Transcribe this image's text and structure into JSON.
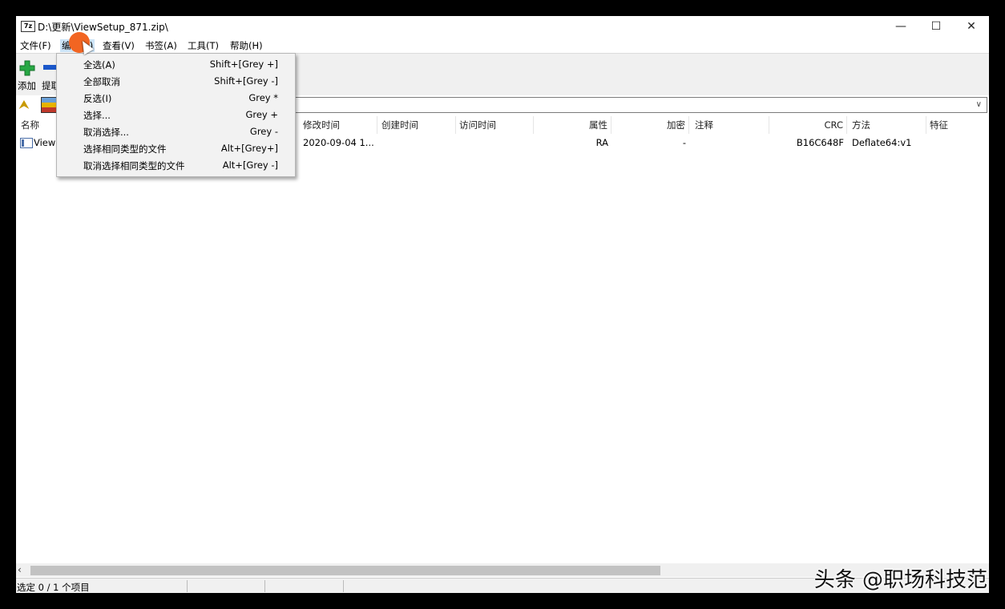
{
  "window": {
    "title": "D:\\更新\\ViewSetup_871.zip\\",
    "app_icon": "7z",
    "controls": {
      "minimize": "—",
      "maximize": "☐",
      "close": "✕"
    }
  },
  "menubar": {
    "items": [
      "文件(F)",
      "编辑(E)",
      "查看(V)",
      "书签(A)",
      "工具(T)",
      "帮助(H)"
    ]
  },
  "toolbar": {
    "add_label": "添加",
    "extract_label": "提取"
  },
  "columns": [
    "名称",
    "修改时间",
    "创建时间",
    "访问时间",
    "属性",
    "加密",
    "注释",
    "CRC",
    "方法",
    "特征"
  ],
  "rows": [
    {
      "name": "View",
      "modified": "2020-09-04 1...",
      "created": "",
      "accessed": "",
      "attr": "RA",
      "encrypted": "-",
      "comment": "",
      "crc": "B16C648F",
      "method": "Deflate64:v1",
      "feature": ""
    }
  ],
  "edit_menu": [
    {
      "label": "全选(A)",
      "shortcut": "Shift+[Grey +]"
    },
    {
      "label": "全部取消",
      "shortcut": "Shift+[Grey -]"
    },
    {
      "label": "反选(I)",
      "shortcut": "Grey *"
    },
    {
      "label": "选择...",
      "shortcut": "Grey +"
    },
    {
      "label": "取消选择...",
      "shortcut": "Grey -"
    },
    {
      "label": "选择相同类型的文件",
      "shortcut": "Alt+[Grey+]"
    },
    {
      "label": "取消选择相同类型的文件",
      "shortcut": "Alt+[Grey -]"
    }
  ],
  "statusbar": {
    "text": "选定 0 / 1 个项目"
  },
  "watermark": "头条 @职场科技范",
  "colors": {
    "accent_cursor": "#f26522",
    "plus_green": "#27a844",
    "minus_blue": "#1a57c9"
  }
}
